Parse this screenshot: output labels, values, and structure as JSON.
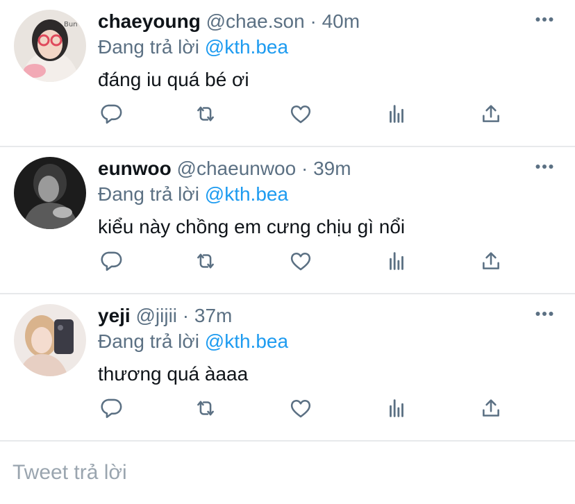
{
  "replies": [
    {
      "name": "chaeyoung",
      "handle": "@chae.son",
      "separator": "·",
      "time": "40m",
      "replying_prefix": "Đang trả lời",
      "replying_to": "@kth.bea",
      "text": "đáng iu quá bé ơi",
      "avatar_icon": "user-photo-avatar"
    },
    {
      "name": "eunwoo",
      "handle": "@chaeunwoo",
      "separator": "·",
      "time": "39m",
      "replying_prefix": "Đang trả lời",
      "replying_to": "@kth.bea",
      "text": "kiểu này chồng em cưng chịu gì nổi",
      "avatar_icon": "user-photo-avatar"
    },
    {
      "name": "yeji",
      "handle": "@jijii",
      "separator": "·",
      "time": "37m",
      "replying_prefix": "Đang trả lời",
      "replying_to": "@kth.bea",
      "text": "thương quá àaaa",
      "avatar_icon": "user-photo-avatar"
    }
  ],
  "action_icons": [
    "reply-icon",
    "retweet-icon",
    "like-icon",
    "analytics-icon",
    "share-icon"
  ],
  "composer": {
    "placeholder": "Tweet trả lời"
  },
  "colors": {
    "accent": "#1d9bf0",
    "secondary_text": "#5b7083",
    "icon": "#5b7083",
    "divider": "#e7e9eb"
  }
}
